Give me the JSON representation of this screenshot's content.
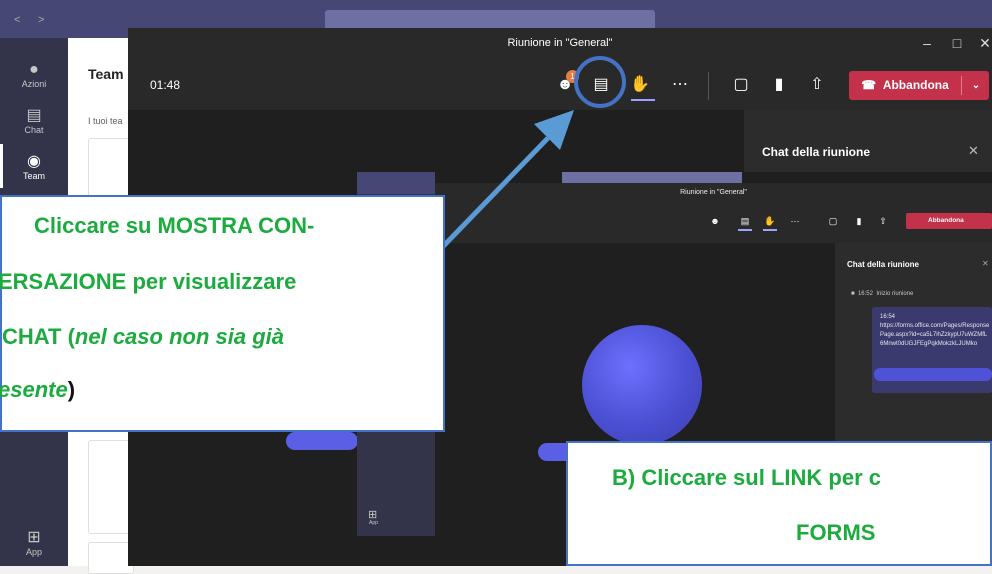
{
  "background_app": {
    "rail_items": [
      {
        "label": "Azioni",
        "icon": "bell-icon"
      },
      {
        "label": "Chat",
        "icon": "chat-icon"
      },
      {
        "label": "Team",
        "icon": "team-icon"
      },
      {
        "label": "App",
        "icon": "apps-icon"
      }
    ],
    "panel_title": "Team",
    "panel_subtitle": "I tuoi tea"
  },
  "meeting_window": {
    "title": "Riunione in \"General\"",
    "timer": "01:48",
    "participants_badge": "1",
    "leave_label": "Abbandona",
    "chat_panel_title": "Chat della riunione"
  },
  "inner_window": {
    "title": "Riunione in \"General\"",
    "leave_label": "Abbandona",
    "rail_app_label": "App",
    "chat_panel_title": "Chat della riunione",
    "event_time": "16:52",
    "event_text": "Inizio riunione",
    "message_time": "16:54",
    "message_link": "https://forms.office.com/Pages/ResponsePage.aspx?id=ca5L7ihZzkypU7uWZMfL6Mnwt0dUGJFEgPqkMokzkLJUMko"
  },
  "callout_a": {
    "line1": "Cliccare su MOSTRA CON-",
    "line2": "ERSAZIONE per visualizzare",
    "line3_bold": "CHAT (",
    "line3_italic": "nel caso non sia già",
    "line4_italic": "esente",
    "line4_end": ")"
  },
  "callout_b": {
    "line1": "B) Cliccare sul LINK per c",
    "line2": "FORMS"
  },
  "colors": {
    "teams_purple": "#464775",
    "leave_red": "#c4314b",
    "callout_green": "#1bab3e",
    "callout_border": "#4472c4"
  }
}
